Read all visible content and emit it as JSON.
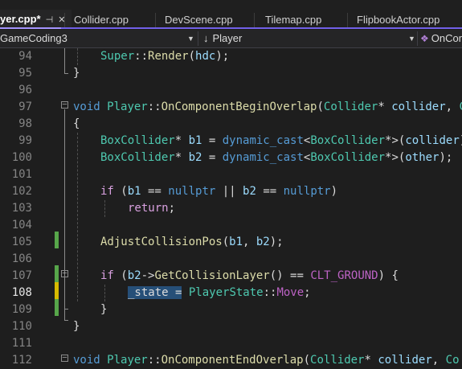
{
  "tabs": [
    {
      "label": "yer.cpp*",
      "active": true
    },
    {
      "label": "Collider.cpp",
      "active": false
    },
    {
      "label": "DevScene.cpp",
      "active": false
    },
    {
      "label": "Tilemap.cpp",
      "active": false
    },
    {
      "label": "FlipbookActor.cpp",
      "active": false
    }
  ],
  "nav": {
    "project": "GameCoding3",
    "scope": "Player",
    "member": "OnCom"
  },
  "icons": {
    "pin": "pin-icon",
    "close": "close-icon",
    "dropdown": "chevron-down-icon",
    "scope": "arrow-down-icon",
    "member": "member-icon"
  },
  "colors": {
    "keyword": "#569cd6",
    "type": "#4ec9b0",
    "function": "#dcdcaa",
    "control": "#d8a0df",
    "variable": "#9cdcfe",
    "macro": "#bd63c5",
    "selection": "#264f78",
    "change_saved": "#57a64a",
    "change_unsaved": "#d7ba00",
    "tab_accent": "#7160e8"
  },
  "editor": {
    "current_line": "108",
    "lines": [
      {
        "num": "94",
        "tokens": [
          [
            "ty",
            "Super"
          ],
          [
            "pl",
            "::"
          ],
          [
            "fn",
            "Render"
          ],
          [
            "pl",
            "("
          ],
          [
            "var",
            "hdc"
          ],
          [
            "pl",
            ");"
          ]
        ]
      },
      {
        "num": "95",
        "tokens": [
          [
            "pl",
            "}"
          ]
        ]
      },
      {
        "num": "96",
        "tokens": []
      },
      {
        "num": "97",
        "tokens": [
          [
            "kw",
            "void"
          ],
          [
            "pl",
            " "
          ],
          [
            "ty",
            "Player"
          ],
          [
            "pl",
            "::"
          ],
          [
            "fn",
            "OnComponentBeginOverlap"
          ],
          [
            "pl",
            "("
          ],
          [
            "ty",
            "Collider"
          ],
          [
            "pl",
            "* "
          ],
          [
            "var",
            "collider"
          ],
          [
            "pl",
            ", "
          ],
          [
            "ty",
            "C"
          ]
        ]
      },
      {
        "num": "98",
        "tokens": [
          [
            "pl",
            "{"
          ]
        ]
      },
      {
        "num": "99",
        "tokens": [
          [
            "ty",
            "BoxCollider"
          ],
          [
            "pl",
            "* "
          ],
          [
            "var",
            "b1"
          ],
          [
            "pl",
            " = "
          ],
          [
            "kw",
            "dynamic_cast"
          ],
          [
            "pl",
            "<"
          ],
          [
            "ty",
            "BoxCollider"
          ],
          [
            "pl",
            "*>("
          ],
          [
            "var",
            "collider"
          ],
          [
            "pl",
            ")"
          ]
        ]
      },
      {
        "num": "100",
        "tokens": [
          [
            "ty",
            "BoxCollider"
          ],
          [
            "pl",
            "* "
          ],
          [
            "var",
            "b2"
          ],
          [
            "pl",
            " = "
          ],
          [
            "kw",
            "dynamic_cast"
          ],
          [
            "pl",
            "<"
          ],
          [
            "ty",
            "BoxCollider"
          ],
          [
            "pl",
            "*>("
          ],
          [
            "var",
            "other"
          ],
          [
            "pl",
            ");"
          ]
        ]
      },
      {
        "num": "101",
        "tokens": []
      },
      {
        "num": "102",
        "tokens": [
          [
            "ctl",
            "if"
          ],
          [
            "pl",
            " ("
          ],
          [
            "var",
            "b1"
          ],
          [
            "pl",
            " == "
          ],
          [
            "kw",
            "nullptr"
          ],
          [
            "pl",
            " || "
          ],
          [
            "var",
            "b2"
          ],
          [
            "pl",
            " == "
          ],
          [
            "kw",
            "nullptr"
          ],
          [
            "pl",
            ")"
          ]
        ]
      },
      {
        "num": "103",
        "tokens": [
          [
            "ctl",
            "return"
          ],
          [
            "pl",
            ";"
          ]
        ]
      },
      {
        "num": "104",
        "tokens": []
      },
      {
        "num": "105",
        "tokens": [
          [
            "fn",
            "AdjustCollisionPos"
          ],
          [
            "pl",
            "("
          ],
          [
            "var",
            "b1"
          ],
          [
            "pl",
            ", "
          ],
          [
            "var",
            "b2"
          ],
          [
            "pl",
            ");"
          ]
        ]
      },
      {
        "num": "106",
        "tokens": []
      },
      {
        "num": "107",
        "tokens": [
          [
            "ctl",
            "if"
          ],
          [
            "pl",
            " ("
          ],
          [
            "var",
            "b2"
          ],
          [
            "pl",
            "->"
          ],
          [
            "fn",
            "GetCollisionLayer"
          ],
          [
            "pl",
            "() == "
          ],
          [
            "macro",
            "CLT_GROUND"
          ],
          [
            "pl",
            ") {"
          ]
        ]
      },
      {
        "num": "108",
        "tokens": [
          [
            "sel",
            "_state ="
          ],
          [
            "pl",
            " "
          ],
          [
            "ty",
            "PlayerState"
          ],
          [
            "pl",
            "::"
          ],
          [
            "macro",
            "Move"
          ],
          [
            "pl",
            ";"
          ]
        ]
      },
      {
        "num": "109",
        "tokens": [
          [
            "pl",
            "}"
          ]
        ]
      },
      {
        "num": "110",
        "tokens": [
          [
            "pl",
            "}"
          ]
        ]
      },
      {
        "num": "111",
        "tokens": []
      },
      {
        "num": "112",
        "tokens": [
          [
            "kw",
            "void"
          ],
          [
            "pl",
            " "
          ],
          [
            "ty",
            "Player"
          ],
          [
            "pl",
            "::"
          ],
          [
            "fn",
            "OnComponentEndOverlap"
          ],
          [
            "pl",
            "("
          ],
          [
            "ty",
            "Collider"
          ],
          [
            "pl",
            "* "
          ],
          [
            "var",
            "collider"
          ],
          [
            "pl",
            ", "
          ],
          [
            "ty",
            "Co"
          ]
        ]
      }
    ]
  }
}
